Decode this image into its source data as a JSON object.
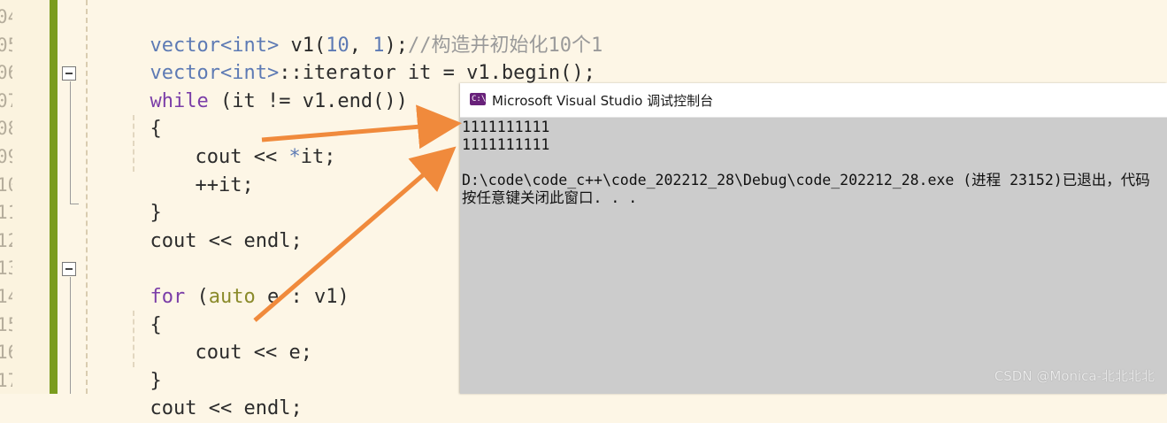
{
  "editor": {
    "line_numbers": [
      "04",
      "05",
      "06",
      "07",
      "08",
      "09",
      "10",
      "11",
      "12",
      "13",
      "14",
      "15",
      "16",
      "17"
    ],
    "code": {
      "l04": {
        "t1": "vector",
        "t2": "<",
        "t3": "int",
        "t4": ">",
        "t5": " v1(",
        "t6": "10",
        "t7": ", ",
        "t8": "1",
        "t9": ");",
        "t10": "//构造并初始化10个1"
      },
      "l05": {
        "t1": "vector",
        "t2": "<",
        "t3": "int",
        "t4": ">",
        "t5": "::iterator it = v1.begin();"
      },
      "l06": {
        "t1": "while",
        "t2": " (it != v1.end())"
      },
      "l07": {
        "t1": "{"
      },
      "l08": {
        "t1": "cout << ",
        "t2": "*",
        "t3": "it;"
      },
      "l09": {
        "t1": "++it;"
      },
      "l10": {
        "t1": "}"
      },
      "l11": {
        "t1": "cout << endl;"
      },
      "l13": {
        "t1": "for",
        "t2": " (",
        "t3": "auto",
        "t4": " e : v1)"
      },
      "l14": {
        "t1": "{"
      },
      "l15": {
        "t1": "cout << e;"
      },
      "l16": {
        "t1": "}"
      },
      "l17": {
        "t1": "cout << endl;"
      }
    }
  },
  "console": {
    "icon_label": "C:\\",
    "title": "Microsoft Visual Studio 调试控制台",
    "lines": [
      "1111111111",
      "1111111111",
      "",
      "D:\\code\\code_c++\\code_202212_28\\Debug\\code_202212_28.exe (进程 23152)已退出，代码",
      "按任意键关闭此窗口. . ."
    ]
  },
  "watermark": "CSDN @Monica-北北北北",
  "colors": {
    "arrow": "#f08a3c",
    "change_bar": "#7a9c1e",
    "console_bg": "#cccccc"
  }
}
